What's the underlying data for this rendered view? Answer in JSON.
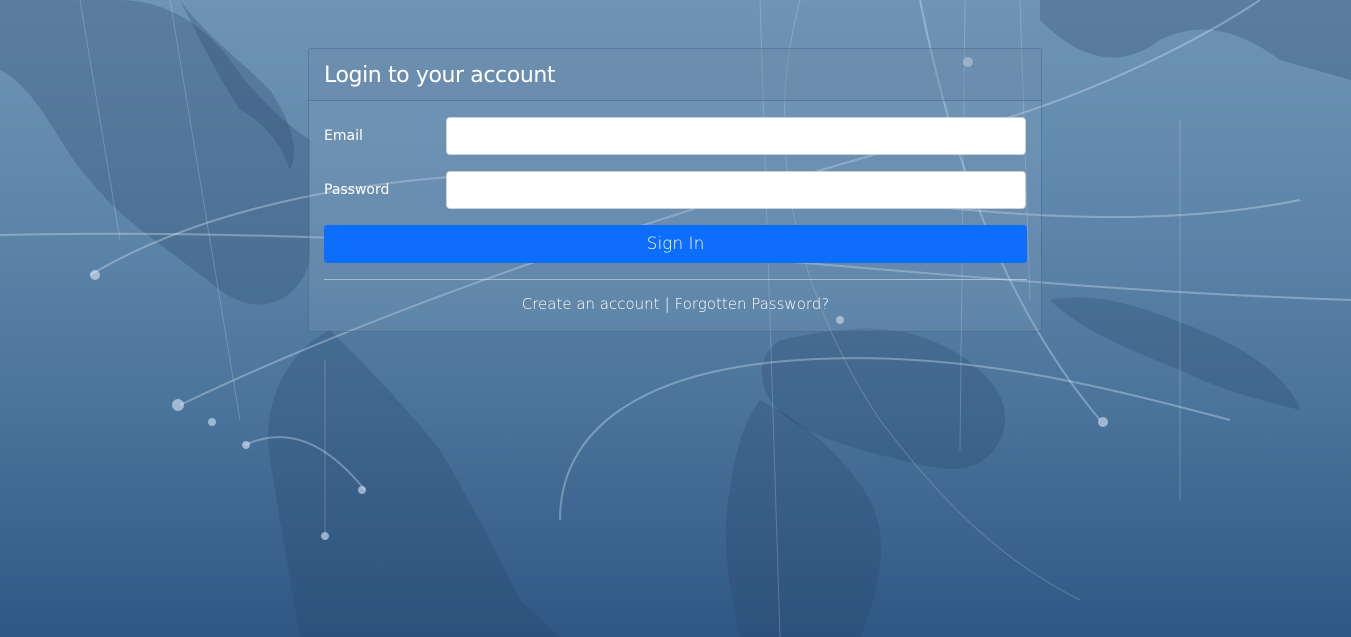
{
  "login": {
    "title": "Login to your account",
    "email_label": "Email",
    "email_value": "",
    "password_label": "Password",
    "password_value": "",
    "signin_label": "Sign In",
    "create_account_link": "Create an account",
    "separator": "|",
    "forgotten_password_link": "Forgotten Password?"
  },
  "colors": {
    "primary_button": "#0d6efd",
    "background_top": "#6f94b5",
    "background_bottom": "#2f5784"
  }
}
